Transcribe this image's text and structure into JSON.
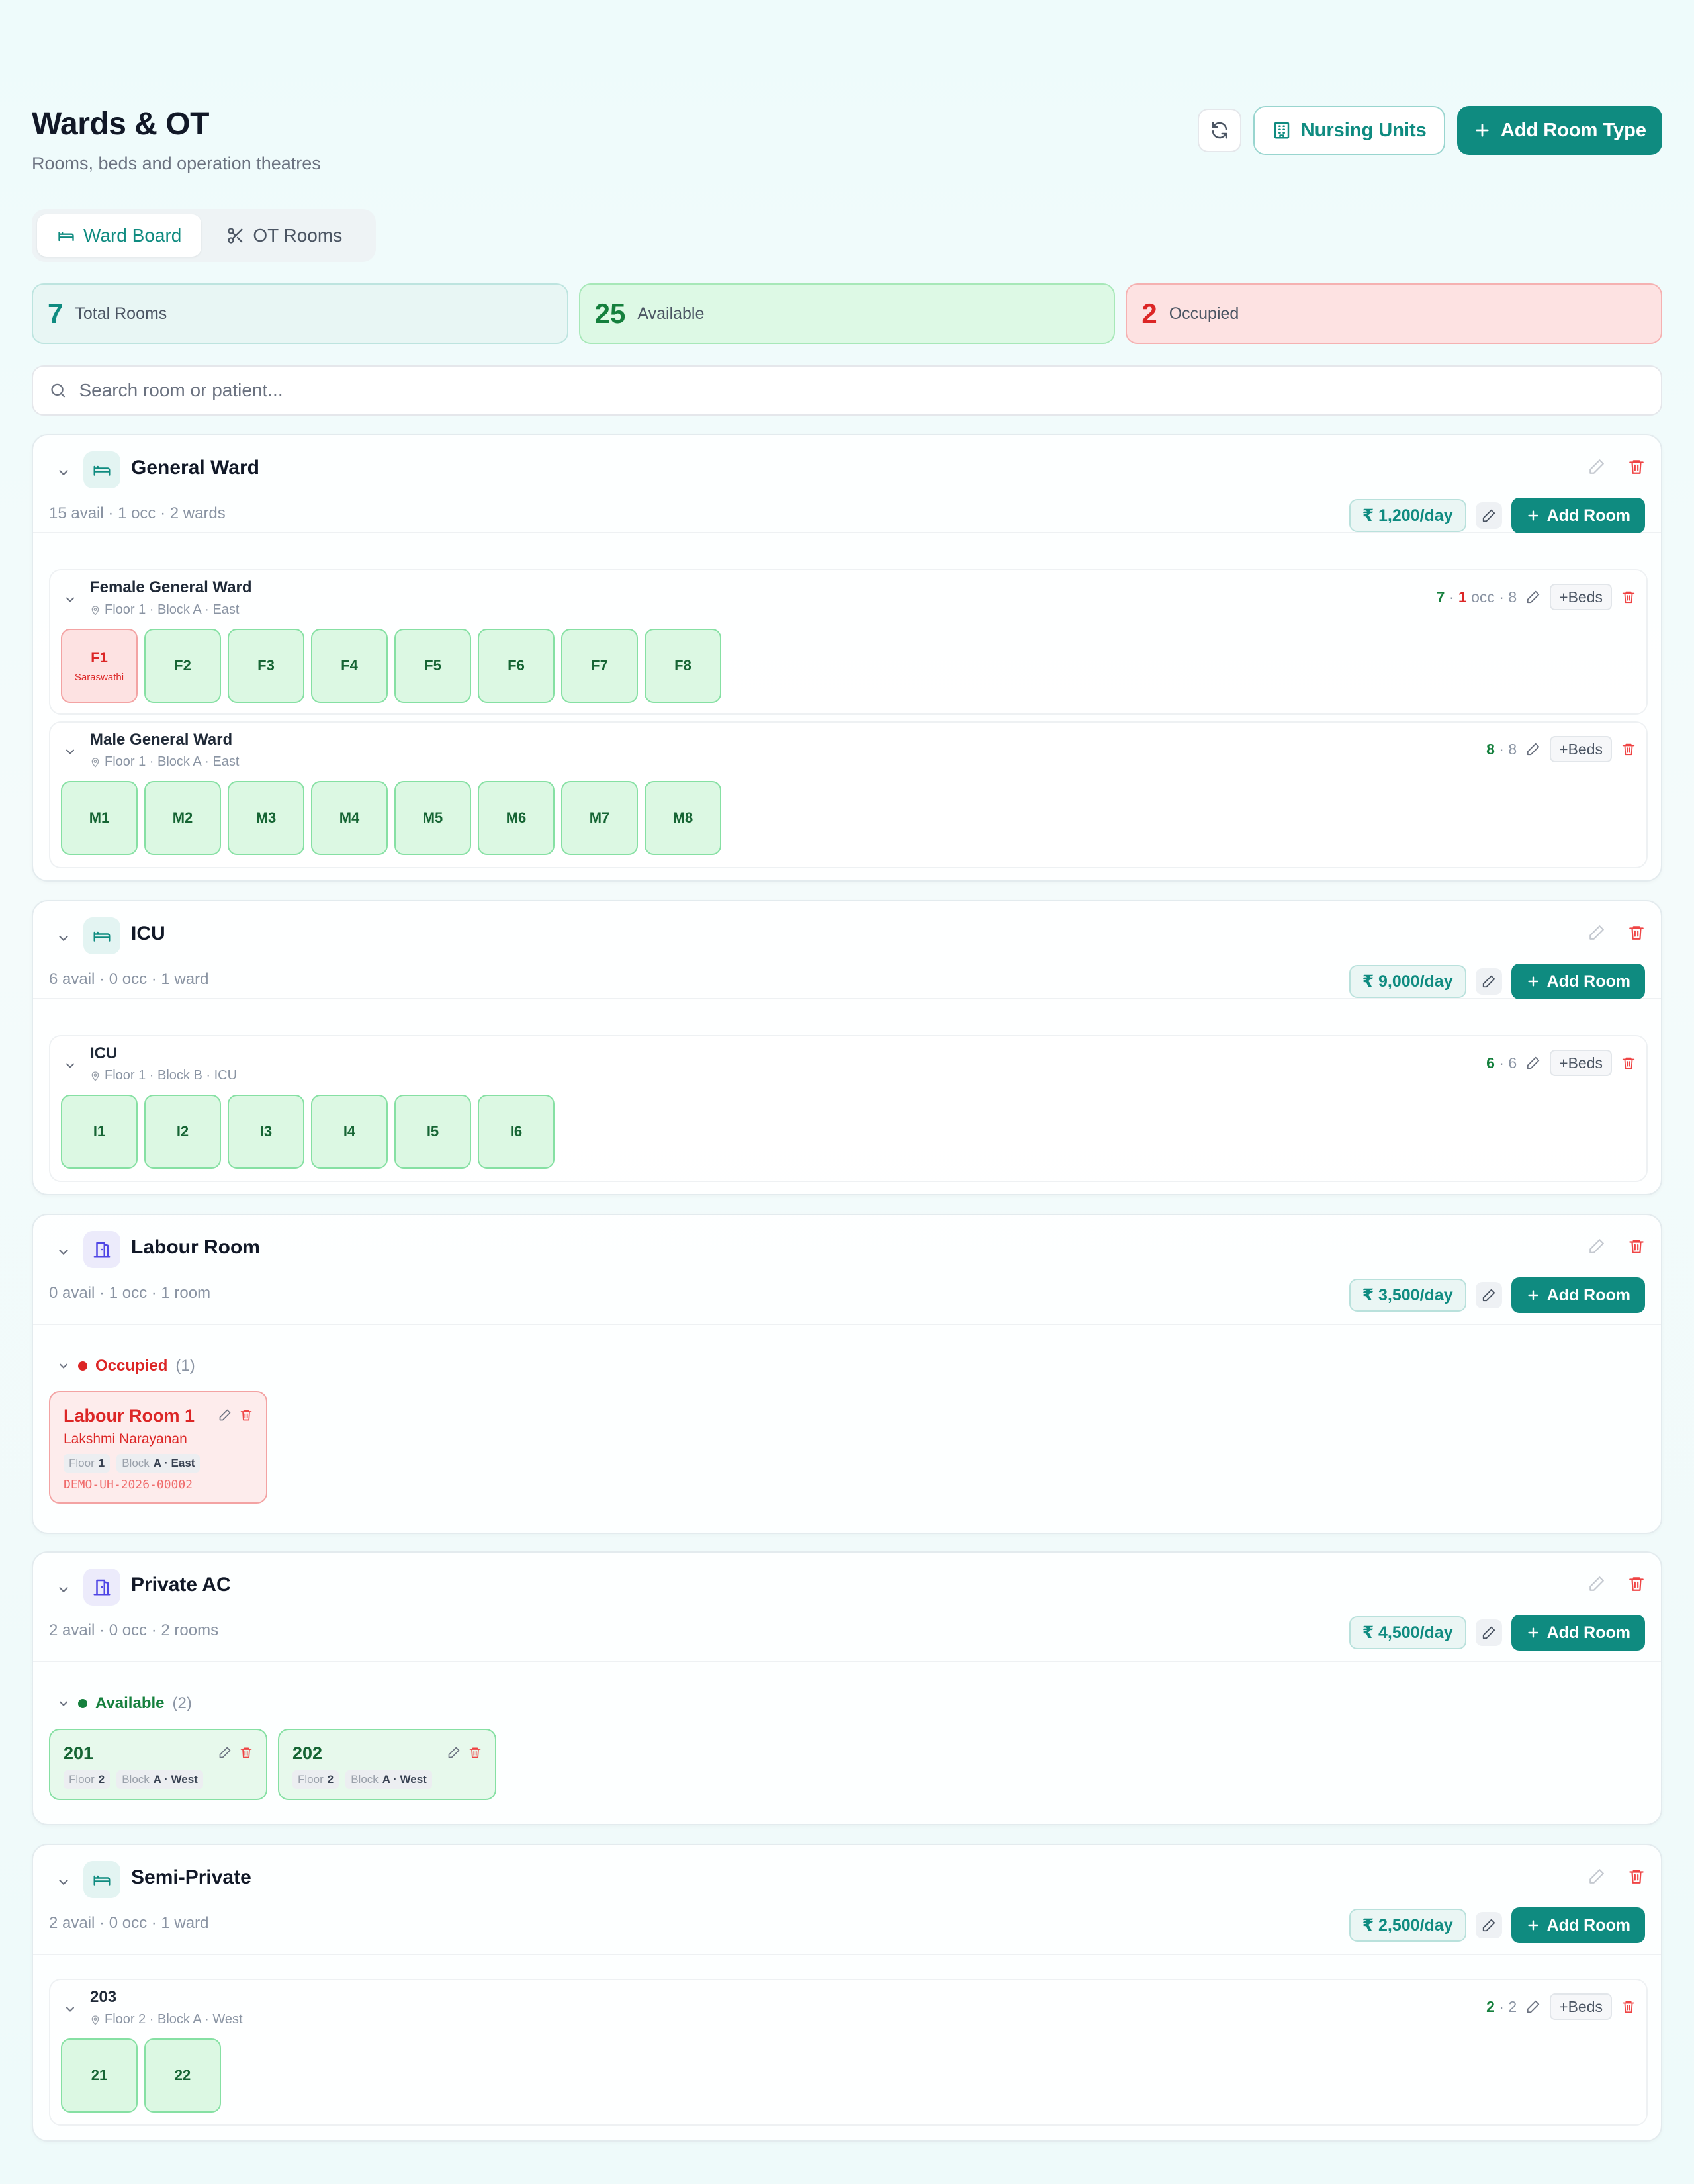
{
  "header": {
    "title": "Wards & OT",
    "subtitle": "Rooms, beds and operation theatres",
    "nursing_units_label": "Nursing Units",
    "add_room_type_label": "Add Room Type"
  },
  "tabs": [
    {
      "label": "Ward Board",
      "active": true
    },
    {
      "label": "OT Rooms",
      "active": false
    }
  ],
  "stats": {
    "total": {
      "value": "7",
      "label": "Total Rooms"
    },
    "available": {
      "value": "25",
      "label": "Available"
    },
    "occupied": {
      "value": "2",
      "label": "Occupied"
    }
  },
  "search": {
    "placeholder": "Search room or patient..."
  },
  "colors": {
    "accent": "#0f8b80",
    "available": "#15803d",
    "occupied": "#dc2626"
  },
  "room_types": [
    {
      "name": "General Ward",
      "meta": "15 avail · 1 occ · 2 wards",
      "price": "₹ 1,200/day",
      "add_room_label": "Add Room",
      "wards": [
        {
          "name": "Female General Ward",
          "location": "Floor 1 · Block A · East",
          "avail": "7",
          "occ": "1",
          "occ_label": "occ",
          "total": "8",
          "beds_label": "+Beds",
          "beds": [
            {
              "label": "F1",
              "patient": "Saraswathi"
            },
            {
              "label": "F2"
            },
            {
              "label": "F3"
            },
            {
              "label": "F4"
            },
            {
              "label": "F5"
            },
            {
              "label": "F6"
            },
            {
              "label": "F7"
            },
            {
              "label": "F8"
            }
          ]
        },
        {
          "name": "Male General Ward",
          "location": "Floor 1 · Block A · East",
          "avail": "8",
          "total": "8",
          "beds_label": "+Beds",
          "beds": [
            {
              "label": "M1"
            },
            {
              "label": "M2"
            },
            {
              "label": "M3"
            },
            {
              "label": "M4"
            },
            {
              "label": "M5"
            },
            {
              "label": "M6"
            },
            {
              "label": "M7"
            },
            {
              "label": "M8"
            }
          ]
        }
      ]
    },
    {
      "name": "ICU",
      "meta": "6 avail · 0 occ · 1 ward",
      "price": "₹ 9,000/day",
      "add_room_label": "Add Room",
      "wards": [
        {
          "name": "ICU",
          "location": "Floor 1 · Block B · ICU",
          "avail": "6",
          "total": "6",
          "beds_label": "+Beds",
          "beds": [
            {
              "label": "I1"
            },
            {
              "label": "I2"
            },
            {
              "label": "I3"
            },
            {
              "label": "I4"
            },
            {
              "label": "I5"
            },
            {
              "label": "I6"
            }
          ]
        }
      ]
    },
    {
      "name": "Labour Room",
      "meta": "0 avail · 1 occ · 1 room",
      "price": "₹ 3,500/day",
      "add_room_label": "Add Room",
      "group": {
        "label": "Occupied",
        "count": "(1)"
      },
      "rooms": [
        {
          "name": "Labour Room 1",
          "patient": "Lakshmi Narayanan",
          "floor_label": "Floor",
          "floor": "1",
          "block_label": "Block",
          "block": "A · East",
          "id": "DEMO-UH-2026-00002"
        }
      ]
    },
    {
      "name": "Private AC",
      "meta": "2 avail · 0 occ · 2 rooms",
      "price": "₹ 4,500/day",
      "add_room_label": "Add Room",
      "group": {
        "label": "Available",
        "count": "(2)"
      },
      "rooms": [
        {
          "name": "201",
          "floor_label": "Floor",
          "floor": "2",
          "block_label": "Block",
          "block": "A · West"
        },
        {
          "name": "202",
          "floor_label": "Floor",
          "floor": "2",
          "block_label": "Block",
          "block": "A · West"
        }
      ]
    },
    {
      "name": "Semi-Private",
      "meta": "2 avail · 0 occ · 1 ward",
      "price": "₹ 2,500/day",
      "add_room_label": "Add Room",
      "wards": [
        {
          "name": "203",
          "location": "Floor 2 · Block A · West",
          "avail": "2",
          "total": "2",
          "beds_label": "+Beds",
          "beds": [
            {
              "label": "21"
            },
            {
              "label": "22"
            }
          ]
        }
      ]
    }
  ]
}
